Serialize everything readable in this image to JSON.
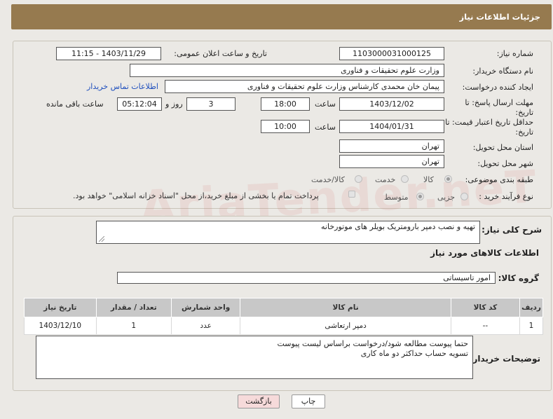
{
  "header": {
    "title": "جزئیات اطلاعات نیاز"
  },
  "form": {
    "need_number": {
      "label": "شماره نیاز:",
      "value": "1103000031000125"
    },
    "announce_datetime": {
      "label": "تاریخ و ساعت اعلان عمومی:",
      "value": "1403/11/29 - 11:15"
    },
    "buyer_org": {
      "label": "نام دستگاه خریدار:",
      "value": "وزارت علوم  تحقیقات و فناوری"
    },
    "requester": {
      "label": "ایجاد کننده درخواست:",
      "value": "پیمان خان محمدی کارشناس وزارت علوم  تحقیقات و فناوری",
      "contact_link": "اطلاعات تماس خریدار"
    },
    "deadline": {
      "label_line1": "مهلت ارسال پاسخ: تا",
      "label_line2": "تاریخ:",
      "date": "1403/12/02",
      "time_label": "ساعت",
      "time": "18:00",
      "days": "3",
      "days_label": "روز و",
      "remaining": "05:12:04",
      "remaining_label": "ساعت باقی مانده"
    },
    "price_validity": {
      "label_line1": "حداقل تاریخ اعتبار قیمت: تا",
      "label_line2": "تاریخ:",
      "date": "1404/01/31",
      "time_label": "ساعت",
      "time": "10:00"
    },
    "province": {
      "label": "استان محل تحویل:",
      "value": "تهران"
    },
    "city": {
      "label": "شهر محل تحویل:",
      "value": "تهران"
    },
    "category": {
      "label": "طبقه بندی موضوعی:",
      "options": [
        "کالا",
        "خدمت",
        "کالا/خدمت"
      ],
      "selected": "کالا"
    },
    "purchase_type": {
      "label": "نوع فرآیند خرید :",
      "options": [
        "جزیی",
        "متوسط"
      ],
      "selected": "متوسط",
      "payment_note": "پرداخت تمام یا بخشی از مبلغ خرید،از محل \"اسناد خزانه اسلامی\" خواهد بود."
    }
  },
  "summary": {
    "label": "شرح کلی نیاز:",
    "value": "تهیه و نصب دمپر بارومتریک بویلر های موتورخانه"
  },
  "goods": {
    "section_title": "اطلاعات کالاهای مورد نیاز",
    "group_label": "گروه کالا:",
    "group_value": "امور تاسیساتی",
    "columns": [
      "ردیف",
      "کد کالا",
      "نام کالا",
      "واحد شمارش",
      "تعداد / مقدار",
      "تاریخ نیاز"
    ],
    "rows": [
      [
        "1",
        "--",
        "دمپر ارتعاشی",
        "عدد",
        "1",
        "1403/12/10"
      ]
    ]
  },
  "buyer_notes": {
    "label": "توضیحات خریدار:",
    "lines": [
      "حتما پیوست مطالعه شود/درخواست براساس لیست پیوست",
      "تسویه حساب حداکثر دو ماه کاری"
    ]
  },
  "buttons": {
    "print": "چاپ",
    "back": "بازگشت"
  },
  "watermark": "AriaTender.neT",
  "colors": {
    "header_bg": "#967a4f",
    "link": "#1f4fbd",
    "back_button_bg": "#f6dada"
  }
}
